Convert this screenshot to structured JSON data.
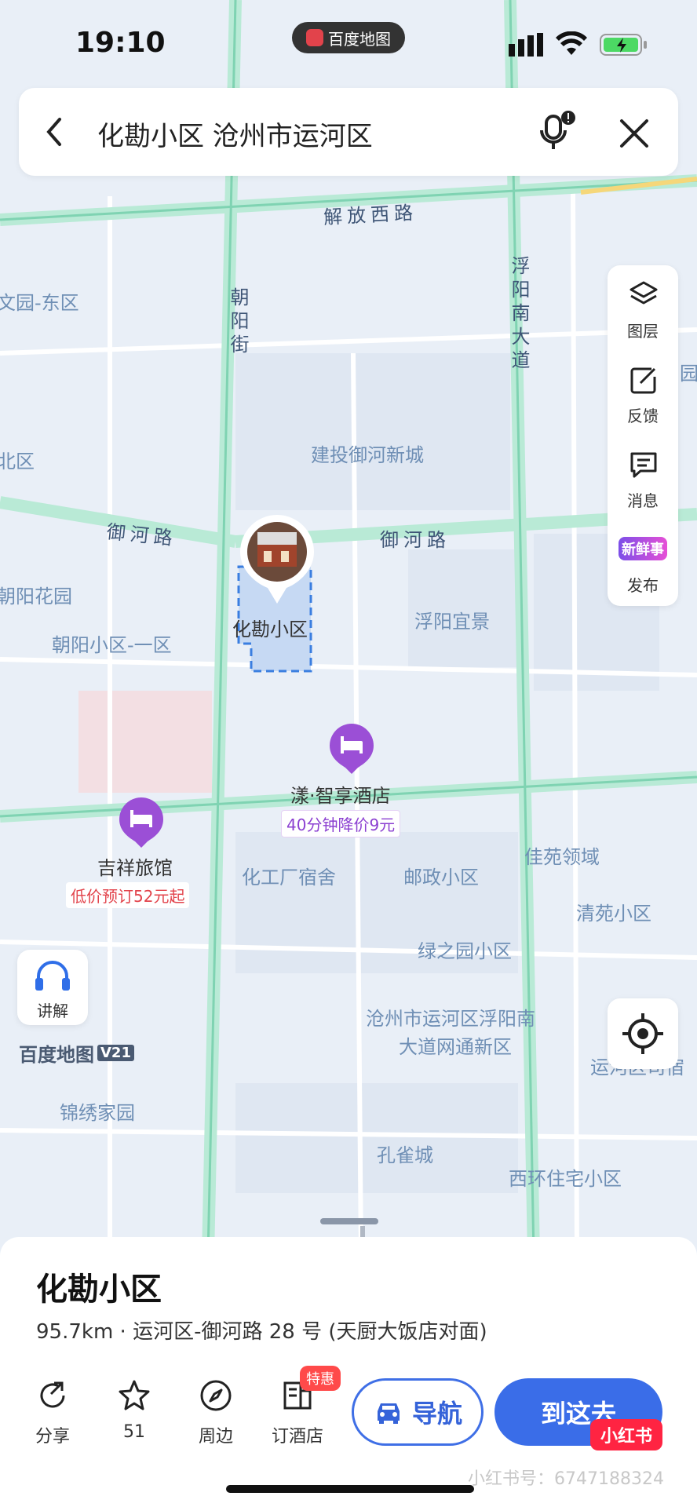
{
  "status_bar": {
    "time": "19:10",
    "app_name": "百度地图"
  },
  "search": {
    "query": "化勘小区 沧州市运河区"
  },
  "side_tools": {
    "layers": "图层",
    "feedback": "反馈",
    "messages": "消息",
    "publish": "发布",
    "publish_badge": "新鲜事"
  },
  "map": {
    "roads": {
      "jiefang_west": "解放西路",
      "chaoyang": "朝阳街",
      "fuyang_south": "浮阳南大道",
      "yuhe_left": "御河路",
      "yuhe_right": "御河路"
    },
    "pois": {
      "wenyuan_east": "文园-东区",
      "north_area": "北区",
      "jiantou": "建投御河新城",
      "chaoyang_garden": "朝阳花园",
      "chaoyang_1": "朝阳小区-一区",
      "fuyang_yijing": "浮阳宜景",
      "huakan": "化勘小区",
      "hotel_yang": "漾·智享酒店",
      "hotel_yang_promo": "40分钟降价9元",
      "jixiang": "吉祥旅馆",
      "jixiang_promo": "低价预订52元起",
      "chemical": "化工厂宿舍",
      "postal": "邮政小区",
      "jiayuan": "佳苑领域",
      "qingyuan": "清苑小区",
      "lvzhiyuan": "绿之园小区",
      "fuyang_south_area_1": "沧州市运河区浮阳南",
      "fuyang_south_area_2": "大道网通新区",
      "yunhe_right": "运河区司宿",
      "jinxiu": "锦绣家园",
      "kongque": "孔雀城",
      "xihuan": "西环住宅小区",
      "yuan_right": "园"
    },
    "narrate": "讲解",
    "brand": "百度地图",
    "version": "V21"
  },
  "place": {
    "name": "化勘小区",
    "address": "95.7km · 运河区-御河路 28 号 (天厨大饭店对面)"
  },
  "actions": {
    "share": "分享",
    "favorite_count": "51",
    "nearby": "周边",
    "hotel": "订酒店",
    "hotel_badge": "特惠",
    "navigate": "导航",
    "go_here": "到这去"
  },
  "watermark": {
    "logo": "小红书",
    "text": "小红书号：6747188324"
  },
  "colors": {
    "accent": "#3a6de8",
    "road": "#b8e8d6",
    "poi_purple": "#9b4fd6"
  }
}
